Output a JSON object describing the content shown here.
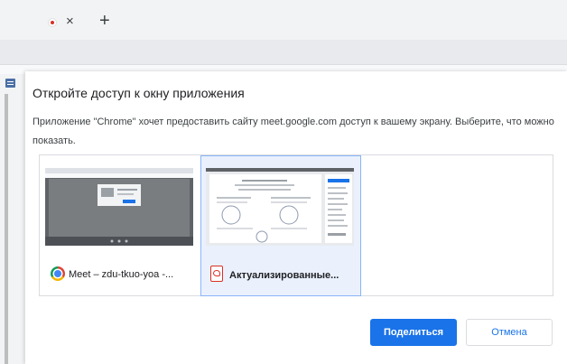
{
  "browser": {
    "tab_close_glyph": "×",
    "new_tab_glyph": "+"
  },
  "dialog": {
    "title": "Откройте доступ к окну приложения",
    "description": "Приложение \"Chrome\" хочет предоставить сайту meet.google.com доступ к вашему экрану. Выберите, что можно показать.",
    "sources": [
      {
        "label": "Meet – zdu-tkuo-yoa -...",
        "icon": "chrome-icon",
        "selected": false
      },
      {
        "label": "Актуализированные...",
        "icon": "pdf-icon",
        "selected": true
      }
    ],
    "share_button": "Поделиться",
    "cancel_button": "Отмена"
  },
  "colors": {
    "accent": "#1a73e8",
    "selected_border": "#8ab4f8",
    "selected_bg": "#eaf1fd",
    "record_red": "#d93025"
  }
}
